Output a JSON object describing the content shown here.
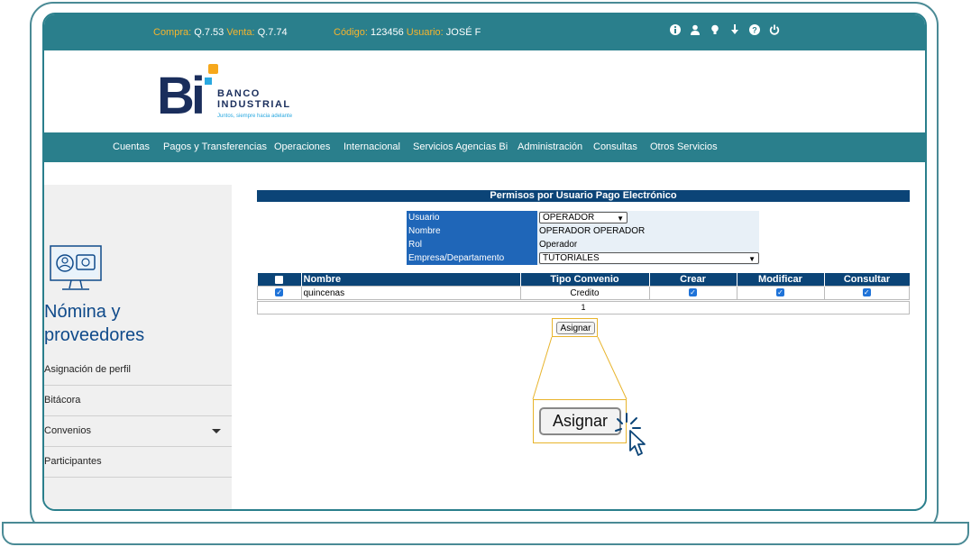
{
  "topbar": {
    "compra_label": "Compra:",
    "compra_value": "Q.7.53",
    "venta_label": "Venta:",
    "venta_value": "Q.7.74",
    "codigo_label": "Código:",
    "codigo_value": "123456",
    "usuario_label": "Usuario:",
    "usuario_value": "JOSÉ F",
    "icons": [
      "info-icon",
      "user-icon",
      "lightbulb-icon",
      "download-icon",
      "help-icon",
      "power-icon"
    ]
  },
  "logo": {
    "mark": "Bi",
    "name_line1": "BANCO",
    "name_line2": "INDUSTRIAL",
    "slogan": "Juntos, siempre hacia adelante"
  },
  "nav": [
    "Cuentas",
    "Pagos y Transferencias",
    "Operaciones",
    "Internacional",
    "Servicios Agencias Bi",
    "Administración",
    "Consultas",
    "Otros Servicios"
  ],
  "sidebar": {
    "title_line1": "Nómina y",
    "title_line2": "proveedores",
    "items": [
      {
        "label": "Asignación de perfil"
      },
      {
        "label": "Bitácora"
      },
      {
        "label": "Convenios"
      },
      {
        "label": "Participantes"
      }
    ]
  },
  "main": {
    "header": "Permisos por Usuario Pago Electrónico",
    "form": {
      "usuario_label": "Usuario",
      "usuario_value": "OPERADOR",
      "nombre_label": "Nombre",
      "nombre_value": "OPERADOR OPERADOR",
      "rol_label": "Rol",
      "rol_value": "Operador",
      "empresa_label": "Empresa/Departamento",
      "empresa_value": "TUTORIALES"
    },
    "table": {
      "columns": [
        "Nombre",
        "Tipo Convenio",
        "Crear",
        "Modificar",
        "Consultar"
      ],
      "rows": [
        {
          "nombre": "quincenas",
          "tipo": "Credito",
          "checked": true,
          "crear": true,
          "modificar": true,
          "consultar": true
        }
      ],
      "page": "1"
    },
    "assign_button": "Asignar",
    "assign_button_zoom": "Asignar"
  },
  "colors": {
    "teal": "#2a7f8c",
    "navy": "#0b4477",
    "label_blue": "#1f66b8",
    "accent_yellow": "#f6b42c",
    "highlight": "#e8b42c"
  }
}
